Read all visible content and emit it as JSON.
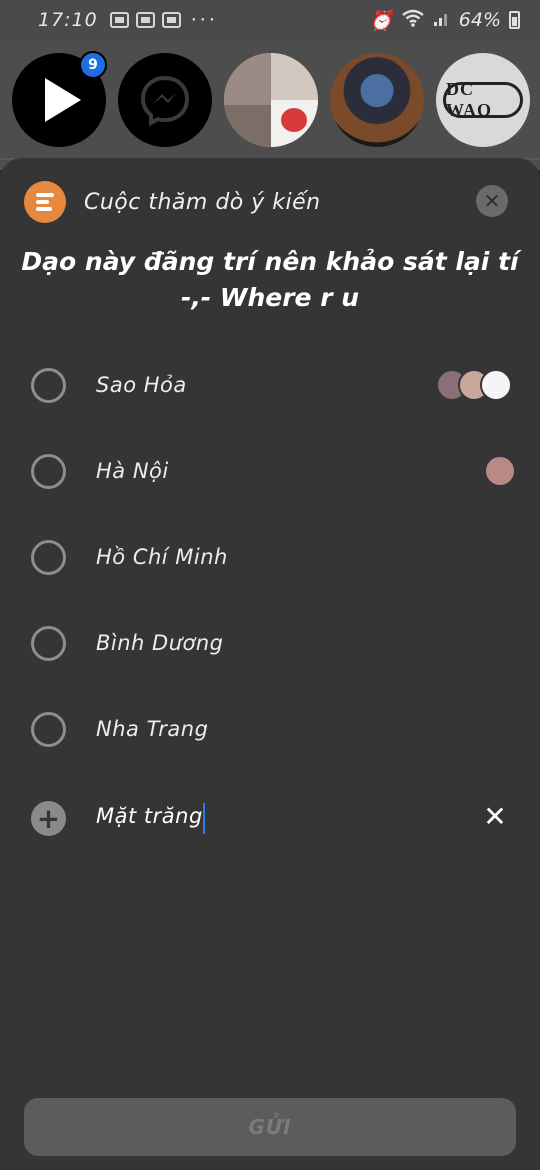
{
  "status_bar": {
    "time": "17:10",
    "battery_percent": "64%",
    "overflow": "···",
    "icons": [
      "gallery-icon",
      "news-icon",
      "vtv-icon",
      "alarm-icon",
      "wifi-icon",
      "signal-icon",
      "battery-icon"
    ]
  },
  "chat_heads": {
    "unread_badge": "9",
    "items": [
      "play-video-head",
      "messenger-head",
      "friend-photo-head",
      "anime-avatar-head",
      "dc-wao-head"
    ],
    "dc_logo_text": "DC WAO"
  },
  "poll": {
    "header_title": "Cuộc thăm dò ý kiến",
    "question": "Dạo này đãng trí nên khảo sát lại tí -,- Where r u",
    "options": [
      {
        "label": "Sao Hỏa",
        "voter_count": 3
      },
      {
        "label": "Hà Nội",
        "voter_count": 1
      },
      {
        "label": "Hồ Chí Minh",
        "voter_count": 0
      },
      {
        "label": "Bình Dương",
        "voter_count": 0
      },
      {
        "label": "Nha Trang",
        "voter_count": 0
      }
    ],
    "new_option_value": "Mặt trăng",
    "send_label": "GỬI"
  },
  "colors": {
    "sheet_bg": "#353535",
    "accent_orange": "#e6893f",
    "badge_blue": "#1d6fe0",
    "cursor_blue": "#2d7be5"
  }
}
